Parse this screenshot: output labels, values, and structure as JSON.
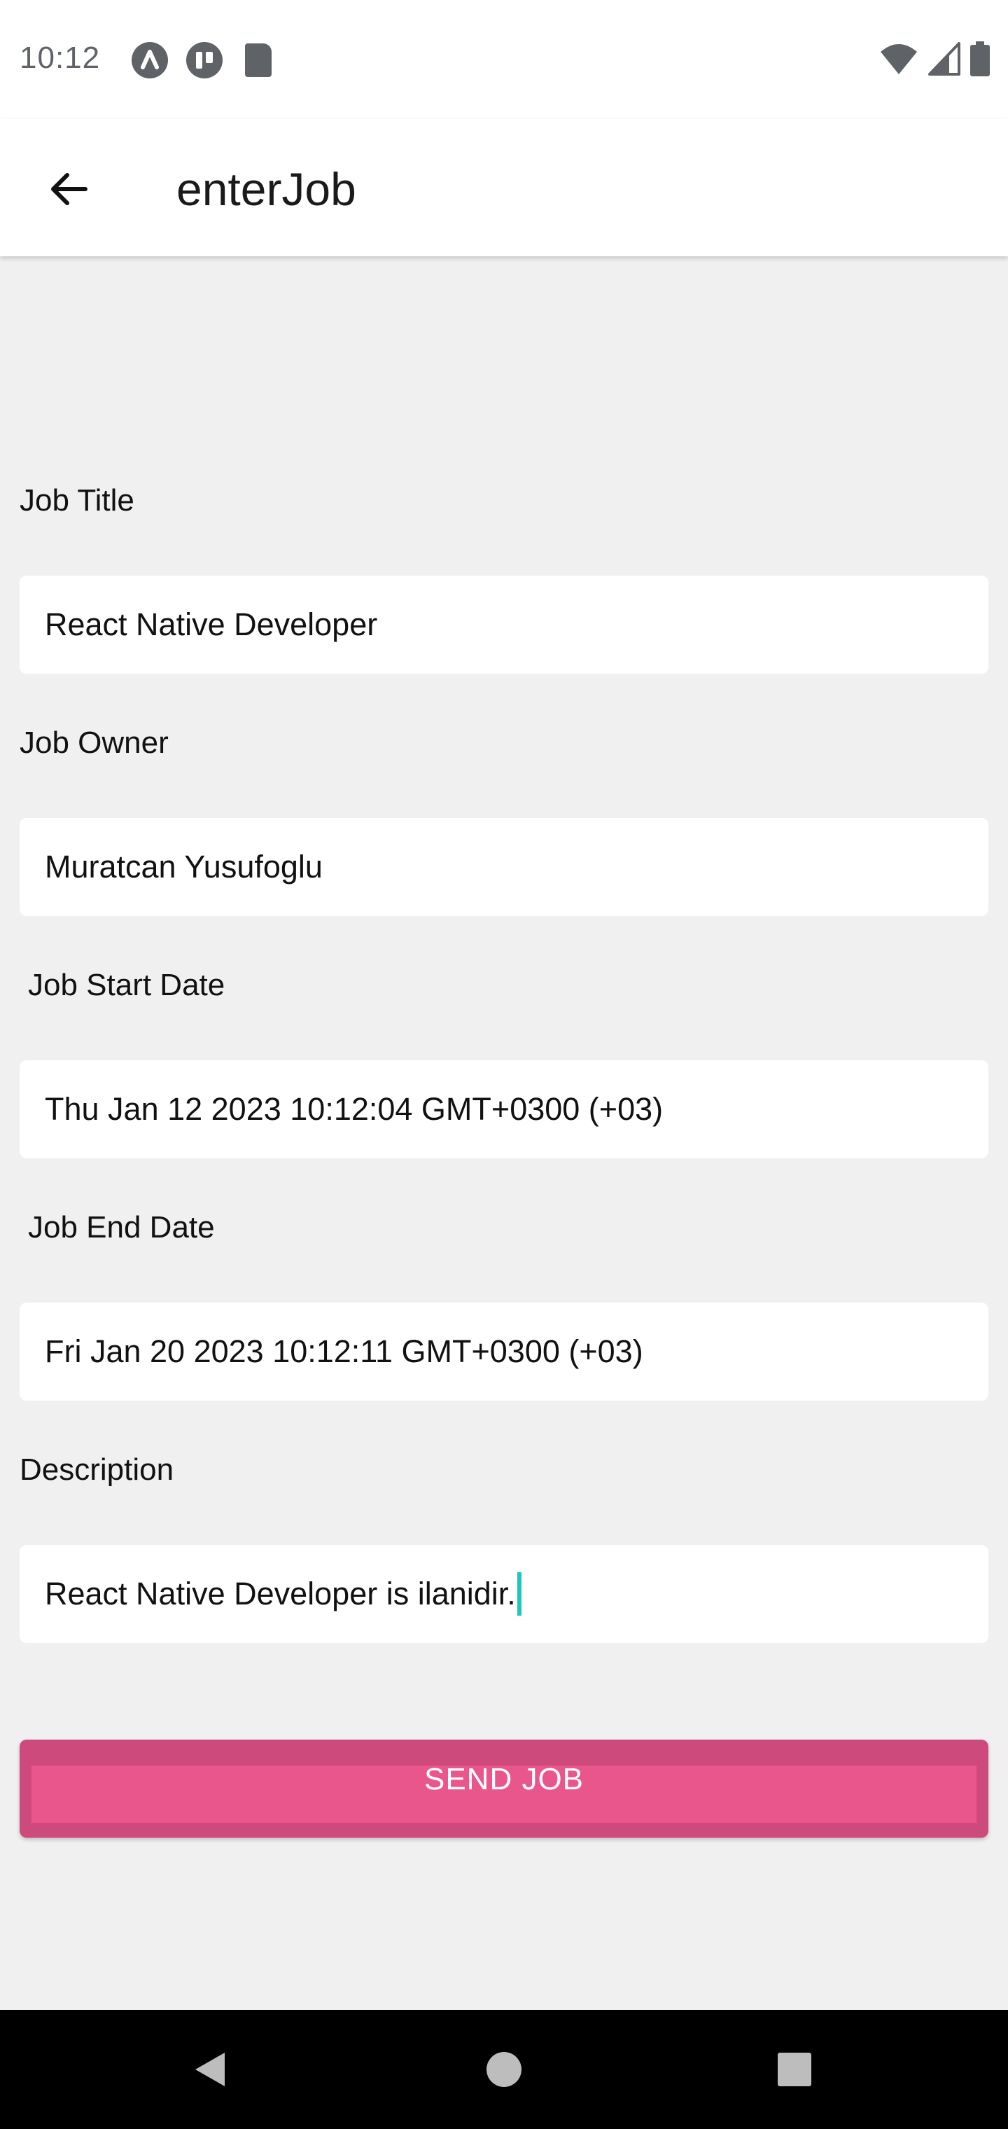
{
  "status_bar": {
    "time": "10:12",
    "left_icons": [
      "arc-icon",
      "app-icon",
      "sd-card-icon"
    ],
    "right_icons": [
      "wifi-icon",
      "signal-icon",
      "battery-icon"
    ]
  },
  "app_bar": {
    "title": "enterJob",
    "back_icon": "arrow-left-icon"
  },
  "form": {
    "job_title": {
      "label": "Job Title",
      "value": "React Native Developer"
    },
    "job_owner": {
      "label": "Job Owner",
      "value": "Muratcan Yusufoglu"
    },
    "start_date": {
      "label": "Job Start Date",
      "value": "Thu Jan 12 2023 10:12:04 GMT+0300 (+03)"
    },
    "end_date": {
      "label": "Job End Date",
      "value": "Fri Jan 20 2023 10:12:11 GMT+0300 (+03)"
    },
    "description": {
      "label": "Description",
      "value": "React Native Developer is ilanidir."
    }
  },
  "send_button": {
    "label": "SEND JOB"
  },
  "colors": {
    "accent_button": "#e9568b",
    "button_border": "#cc4b7c",
    "caret": "#1ec8b8",
    "background": "#f0f0f0"
  },
  "nav_bar": {
    "back_icon": "triangle-back-icon",
    "home_icon": "circle-home-icon",
    "recents_icon": "square-recents-icon"
  }
}
